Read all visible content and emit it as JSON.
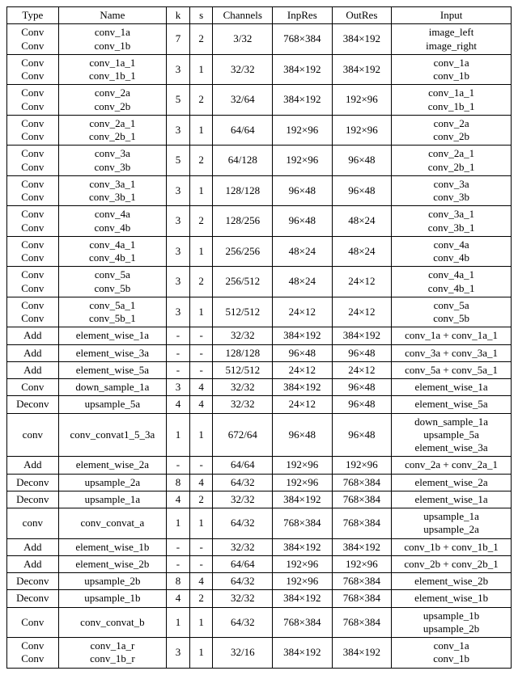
{
  "headers": [
    "Type",
    "Name",
    "k",
    "s",
    "Channels",
    "InpRes",
    "OutRes",
    "Input"
  ],
  "rows": [
    {
      "type": "Conv\nConv",
      "name": "conv_1a\nconv_1b",
      "k": "7",
      "s": "2",
      "ch": "3/32",
      "in": "768×384",
      "out": "384×192",
      "inp": "image_left\nimage_right"
    },
    {
      "type": "Conv\nConv",
      "name": "conv_1a_1\nconv_1b_1",
      "k": "3",
      "s": "1",
      "ch": "32/32",
      "in": "384×192",
      "out": "384×192",
      "inp": "conv_1a\nconv_1b"
    },
    {
      "type": "Conv\nConv",
      "name": "conv_2a\nconv_2b",
      "k": "5",
      "s": "2",
      "ch": "32/64",
      "in": "384×192",
      "out": "192×96",
      "inp": "conv_1a_1\nconv_1b_1"
    },
    {
      "type": "Conv\nConv",
      "name": "conv_2a_1\nconv_2b_1",
      "k": "3",
      "s": "1",
      "ch": "64/64",
      "in": "192×96",
      "out": "192×96",
      "inp": "conv_2a\nconv_2b"
    },
    {
      "type": "Conv\nConv",
      "name": "conv_3a\nconv_3b",
      "k": "5",
      "s": "2",
      "ch": "64/128",
      "in": "192×96",
      "out": "96×48",
      "inp": "conv_2a_1\nconv_2b_1"
    },
    {
      "type": "Conv\nConv",
      "name": "conv_3a_1\nconv_3b_1",
      "k": "3",
      "s": "1",
      "ch": "128/128",
      "in": "96×48",
      "out": "96×48",
      "inp": "conv_3a\nconv_3b"
    },
    {
      "type": "Conv\nConv",
      "name": "conv_4a\nconv_4b",
      "k": "3",
      "s": "2",
      "ch": "128/256",
      "in": "96×48",
      "out": "48×24",
      "inp": "conv_3a_1\nconv_3b_1"
    },
    {
      "type": "Conv\nConv",
      "name": "conv_4a_1\nconv_4b_1",
      "k": "3",
      "s": "1",
      "ch": "256/256",
      "in": "48×24",
      "out": "48×24",
      "inp": "conv_4a\nconv_4b"
    },
    {
      "type": "Conv\nConv",
      "name": "conv_5a\nconv_5b",
      "k": "3",
      "s": "2",
      "ch": "256/512",
      "in": "48×24",
      "out": "24×12",
      "inp": "conv_4a_1\nconv_4b_1"
    },
    {
      "type": "Conv\nConv",
      "name": "conv_5a_1\nconv_5b_1",
      "k": "3",
      "s": "1",
      "ch": "512/512",
      "in": "24×12",
      "out": "24×12",
      "inp": "conv_5a\nconv_5b"
    },
    {
      "type": "Add",
      "name": "element_wise_1a",
      "k": "-",
      "s": "-",
      "ch": "32/32",
      "in": "384×192",
      "out": "384×192",
      "inp": "conv_1a + conv_1a_1"
    },
    {
      "type": "Add",
      "name": "element_wise_3a",
      "k": "-",
      "s": "-",
      "ch": "128/128",
      "in": "96×48",
      "out": "96×48",
      "inp": "conv_3a + conv_3a_1"
    },
    {
      "type": "Add",
      "name": "element_wise_5a",
      "k": "-",
      "s": "-",
      "ch": "512/512",
      "in": "24×12",
      "out": "24×12",
      "inp": "conv_5a + conv_5a_1"
    },
    {
      "type": "Conv",
      "name": "down_sample_1a",
      "k": "3",
      "s": "4",
      "ch": "32/32",
      "in": "384×192",
      "out": "96×48",
      "inp": "element_wise_1a"
    },
    {
      "type": "Deconv",
      "name": "upsample_5a",
      "k": "4",
      "s": "4",
      "ch": "32/32",
      "in": "24×12",
      "out": "96×48",
      "inp": "element_wise_5a"
    },
    {
      "type": "conv",
      "name": "conv_convat1_5_3a",
      "k": "1",
      "s": "1",
      "ch": "672/64",
      "in": "96×48",
      "out": "96×48",
      "inp": "down_sample_1a\nupsample_5a\nelement_wise_3a"
    },
    {
      "type": "Add",
      "name": "element_wise_2a",
      "k": "-",
      "s": "-",
      "ch": "64/64",
      "in": "192×96",
      "out": "192×96",
      "inp": "conv_2a + conv_2a_1"
    },
    {
      "type": "Deconv",
      "name": "upsample_2a",
      "k": "8",
      "s": "4",
      "ch": "64/32",
      "in": "192×96",
      "out": "768×384",
      "inp": "element_wise_2a"
    },
    {
      "type": "Deconv",
      "name": "upsample_1a",
      "k": "4",
      "s": "2",
      "ch": "32/32",
      "in": "384×192",
      "out": "768×384",
      "inp": "element_wise_1a"
    },
    {
      "type": "conv",
      "name": "conv_convat_a",
      "k": "1",
      "s": "1",
      "ch": "64/32",
      "in": "768×384",
      "out": "768×384",
      "inp": "upsample_1a\nupsample_2a"
    },
    {
      "type": "Add",
      "name": "element_wise_1b",
      "k": "-",
      "s": "-",
      "ch": "32/32",
      "in": "384×192",
      "out": "384×192",
      "inp": "conv_1b + conv_1b_1"
    },
    {
      "type": "Add",
      "name": "element_wise_2b",
      "k": "-",
      "s": "-",
      "ch": "64/64",
      "in": "192×96",
      "out": "192×96",
      "inp": "conv_2b + conv_2b_1"
    },
    {
      "type": "Deconv",
      "name": "upsample_2b",
      "k": "8",
      "s": "4",
      "ch": "64/32",
      "in": "192×96",
      "out": "768×384",
      "inp": "element_wise_2b"
    },
    {
      "type": "Deconv",
      "name": "upsample_1b",
      "k": "4",
      "s": "2",
      "ch": "32/32",
      "in": "384×192",
      "out": "768×384",
      "inp": "element_wise_1b"
    },
    {
      "type": "Conv",
      "name": "conv_convat_b",
      "k": "1",
      "s": "1",
      "ch": "64/32",
      "in": "768×384",
      "out": "768×384",
      "inp": "upsample_1b\nupsample_2b"
    },
    {
      "type": "Conv\nConv",
      "name": "conv_1a_r\nconv_1b_r",
      "k": "3",
      "s": "1",
      "ch": "32/16",
      "in": "384×192",
      "out": "384×192",
      "inp": "conv_1a\nconv_1b"
    }
  ]
}
